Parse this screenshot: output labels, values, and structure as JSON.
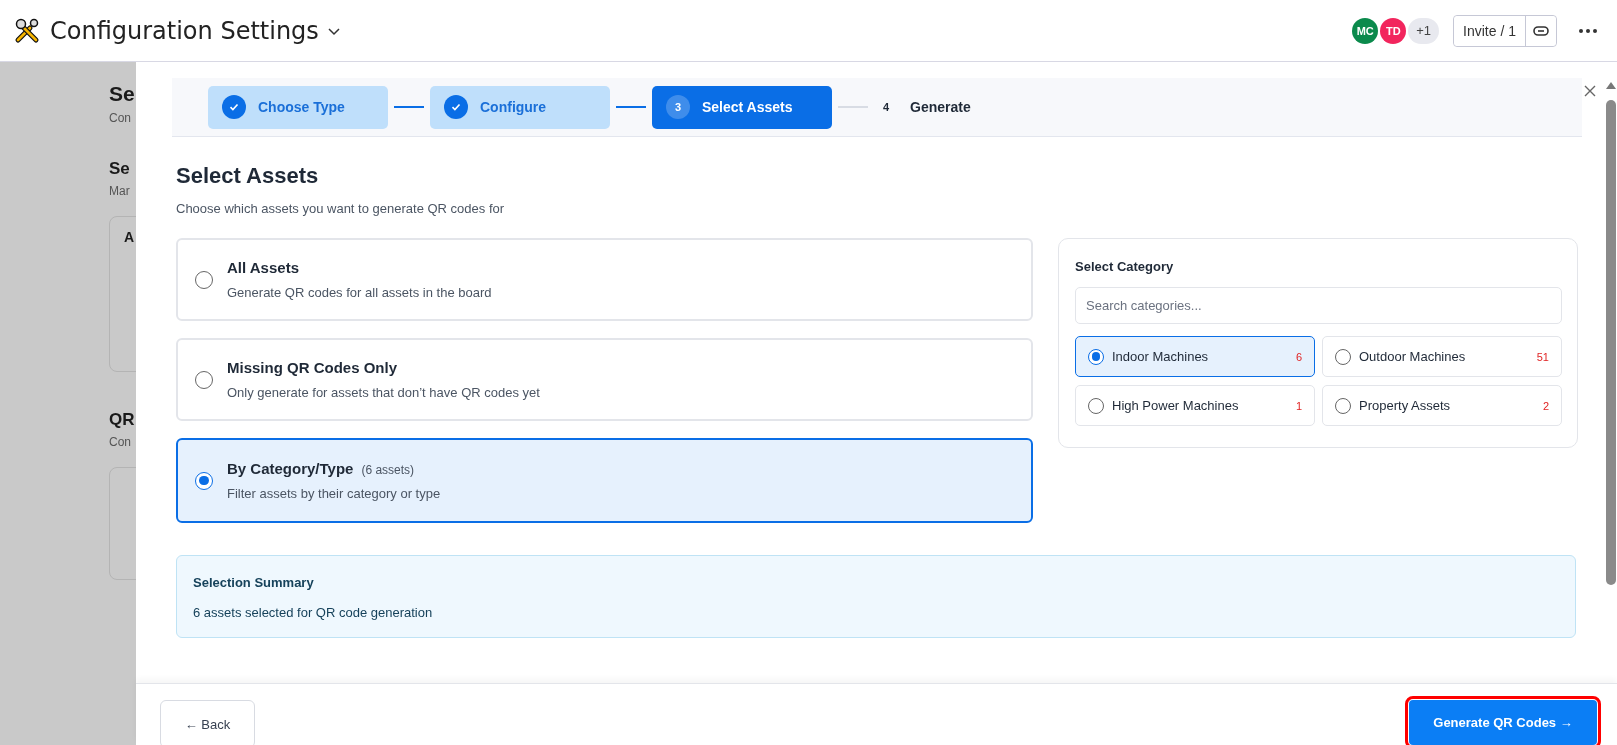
{
  "header": {
    "title": "Configuration Settings",
    "avatars": [
      {
        "initials": "MC",
        "color": "#0b8a4c"
      },
      {
        "initials": "TD",
        "color": "#f2255d"
      }
    ],
    "more_count": "+1",
    "invite_button": "Invite / 1"
  },
  "backdrop": {
    "title": "Se",
    "subtitle": "Con",
    "section_1_title": "Se",
    "section_1_subtitle": "Mar",
    "card_label": "A",
    "section_2_title": "QR",
    "section_2_subtitle": "Con"
  },
  "modal": {
    "steps": [
      {
        "label": "Choose Type",
        "completed": true,
        "selected": false
      },
      {
        "label": "Configure",
        "completed": true,
        "selected": false
      },
      {
        "number": "3",
        "label": "Select Assets",
        "completed": false,
        "selected": true
      },
      {
        "number": "4",
        "label": "Generate",
        "completed": false,
        "selected": false
      }
    ],
    "heading": "Select Assets",
    "subheading": "Choose which assets you want to generate QR codes for",
    "options": [
      {
        "title": "All Assets",
        "description": "Generate QR codes for all assets in the board",
        "selected": false
      },
      {
        "title": "Missing QR Codes Only",
        "description": "Only generate for assets that don’t have QR codes yet",
        "selected": false
      },
      {
        "title": "By Category/Type",
        "count": "(6 assets)",
        "description": "Filter assets by their category or type",
        "selected": true
      }
    ],
    "category_panel": {
      "title": "Select Category",
      "search_placeholder": "Search categories...",
      "categories": [
        {
          "name": "Indoor Machines",
          "count": "6",
          "selected": true
        },
        {
          "name": "Outdoor Machines",
          "count": "51",
          "selected": false
        },
        {
          "name": "High Power Machines",
          "count": "1",
          "selected": false
        },
        {
          "name": "Property Assets",
          "count": "2",
          "selected": false
        }
      ]
    },
    "summary": {
      "title": "Selection Summary",
      "text": "6 assets selected for QR code generation"
    },
    "footer": {
      "back_button": "← Back",
      "generate_button": "Generate QR Codes →",
      "highlighted": true
    }
  }
}
